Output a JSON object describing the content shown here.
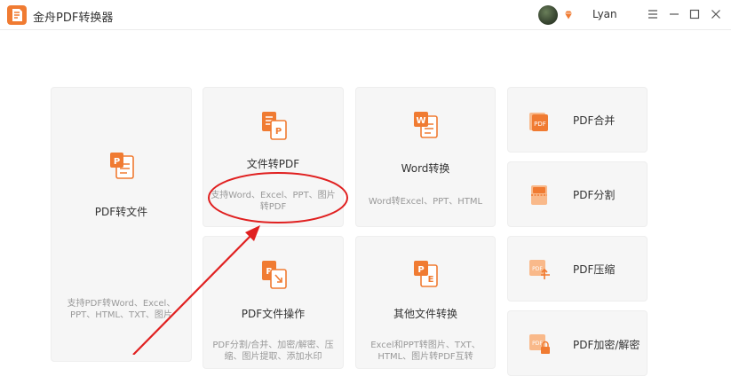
{
  "app": {
    "title": "金舟PDF转换器"
  },
  "user": {
    "name": "Lyan"
  },
  "cards": {
    "pdf_to_file": {
      "title": "PDF转文件",
      "desc": "支持PDF转Word、Excel、PPT、HTML、TXT、图片"
    },
    "file_to_pdf": {
      "title": "文件转PDF",
      "desc": "支持Word、Excel、PPT、图片转PDF"
    },
    "word_convert": {
      "title": "Word转换",
      "desc": "Word转Excel、PPT、HTML"
    },
    "pdf_operation": {
      "title": "PDF文件操作",
      "desc": "PDF分割/合并、加密/解密、压缩、图片提取、添加水印"
    },
    "other_convert": {
      "title": "其他文件转换",
      "desc": "Excel和PPT转图片、TXT、HTML、图片转PDF互转"
    }
  },
  "side_items": [
    {
      "title": "PDF合并"
    },
    {
      "title": "PDF分割"
    },
    {
      "title": "PDF压缩"
    },
    {
      "title": "PDF加密/解密"
    }
  ],
  "colors": {
    "brand_orange": "#f07b32",
    "annotation_red": "#e02020",
    "card_bg": "#f6f6f6"
  }
}
